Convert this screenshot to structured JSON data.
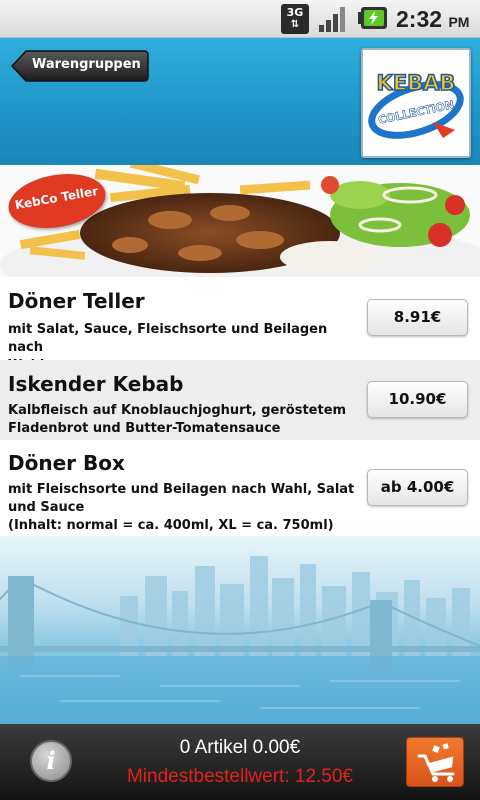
{
  "status_bar": {
    "network": "3G",
    "time": "2:32",
    "ampm": "PM"
  },
  "header": {
    "back_label": "Warengruppen",
    "logo_text_top": "KEBAB",
    "logo_text_bottom": "COLLECTION"
  },
  "banner": {
    "badge": "KebCo Teller"
  },
  "menu": {
    "items": [
      {
        "title": "Döner Teller",
        "description": "mit Salat, Sauce, Fleischsorte und Beilagen nach\nWahl",
        "price": "8.91€"
      },
      {
        "title": "Iskender Kebab",
        "description": "Kalbfleisch auf Knoblauchjoghurt, geröstetem\nFladenbrot und Butter-Tomatensauce",
        "price": "10.90€"
      },
      {
        "title": "Döner Box",
        "description": "mit Fleischsorte und Beilagen nach Wahl, Salat\nund Sauce\n(Inhalt: normal = ca. 400ml, XL = ca. 750ml)",
        "price": "ab 4.00€"
      }
    ]
  },
  "bottom_bar": {
    "info_label": "i",
    "cart_summary": "0 Artikel 0.00€",
    "minimum_order": "Mindestbestellwert: 12.50€"
  },
  "colors": {
    "header_blue": "#1f95c8",
    "warning_red": "#e3201b",
    "cart_orange": "#e8641f"
  }
}
